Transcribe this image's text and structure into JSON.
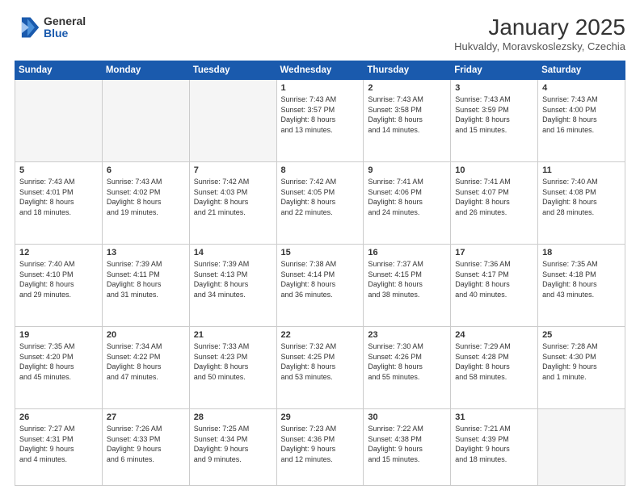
{
  "logo": {
    "general": "General",
    "blue": "Blue"
  },
  "header": {
    "title": "January 2025",
    "location": "Hukvaldy, Moravskoslezsky, Czechia"
  },
  "weekdays": [
    "Sunday",
    "Monday",
    "Tuesday",
    "Wednesday",
    "Thursday",
    "Friday",
    "Saturday"
  ],
  "weeks": [
    [
      {
        "day": "",
        "info": ""
      },
      {
        "day": "",
        "info": ""
      },
      {
        "day": "",
        "info": ""
      },
      {
        "day": "1",
        "info": "Sunrise: 7:43 AM\nSunset: 3:57 PM\nDaylight: 8 hours\nand 13 minutes."
      },
      {
        "day": "2",
        "info": "Sunrise: 7:43 AM\nSunset: 3:58 PM\nDaylight: 8 hours\nand 14 minutes."
      },
      {
        "day": "3",
        "info": "Sunrise: 7:43 AM\nSunset: 3:59 PM\nDaylight: 8 hours\nand 15 minutes."
      },
      {
        "day": "4",
        "info": "Sunrise: 7:43 AM\nSunset: 4:00 PM\nDaylight: 8 hours\nand 16 minutes."
      }
    ],
    [
      {
        "day": "5",
        "info": "Sunrise: 7:43 AM\nSunset: 4:01 PM\nDaylight: 8 hours\nand 18 minutes."
      },
      {
        "day": "6",
        "info": "Sunrise: 7:43 AM\nSunset: 4:02 PM\nDaylight: 8 hours\nand 19 minutes."
      },
      {
        "day": "7",
        "info": "Sunrise: 7:42 AM\nSunset: 4:03 PM\nDaylight: 8 hours\nand 21 minutes."
      },
      {
        "day": "8",
        "info": "Sunrise: 7:42 AM\nSunset: 4:05 PM\nDaylight: 8 hours\nand 22 minutes."
      },
      {
        "day": "9",
        "info": "Sunrise: 7:41 AM\nSunset: 4:06 PM\nDaylight: 8 hours\nand 24 minutes."
      },
      {
        "day": "10",
        "info": "Sunrise: 7:41 AM\nSunset: 4:07 PM\nDaylight: 8 hours\nand 26 minutes."
      },
      {
        "day": "11",
        "info": "Sunrise: 7:40 AM\nSunset: 4:08 PM\nDaylight: 8 hours\nand 28 minutes."
      }
    ],
    [
      {
        "day": "12",
        "info": "Sunrise: 7:40 AM\nSunset: 4:10 PM\nDaylight: 8 hours\nand 29 minutes."
      },
      {
        "day": "13",
        "info": "Sunrise: 7:39 AM\nSunset: 4:11 PM\nDaylight: 8 hours\nand 31 minutes."
      },
      {
        "day": "14",
        "info": "Sunrise: 7:39 AM\nSunset: 4:13 PM\nDaylight: 8 hours\nand 34 minutes."
      },
      {
        "day": "15",
        "info": "Sunrise: 7:38 AM\nSunset: 4:14 PM\nDaylight: 8 hours\nand 36 minutes."
      },
      {
        "day": "16",
        "info": "Sunrise: 7:37 AM\nSunset: 4:15 PM\nDaylight: 8 hours\nand 38 minutes."
      },
      {
        "day": "17",
        "info": "Sunrise: 7:36 AM\nSunset: 4:17 PM\nDaylight: 8 hours\nand 40 minutes."
      },
      {
        "day": "18",
        "info": "Sunrise: 7:35 AM\nSunset: 4:18 PM\nDaylight: 8 hours\nand 43 minutes."
      }
    ],
    [
      {
        "day": "19",
        "info": "Sunrise: 7:35 AM\nSunset: 4:20 PM\nDaylight: 8 hours\nand 45 minutes."
      },
      {
        "day": "20",
        "info": "Sunrise: 7:34 AM\nSunset: 4:22 PM\nDaylight: 8 hours\nand 47 minutes."
      },
      {
        "day": "21",
        "info": "Sunrise: 7:33 AM\nSunset: 4:23 PM\nDaylight: 8 hours\nand 50 minutes."
      },
      {
        "day": "22",
        "info": "Sunrise: 7:32 AM\nSunset: 4:25 PM\nDaylight: 8 hours\nand 53 minutes."
      },
      {
        "day": "23",
        "info": "Sunrise: 7:30 AM\nSunset: 4:26 PM\nDaylight: 8 hours\nand 55 minutes."
      },
      {
        "day": "24",
        "info": "Sunrise: 7:29 AM\nSunset: 4:28 PM\nDaylight: 8 hours\nand 58 minutes."
      },
      {
        "day": "25",
        "info": "Sunrise: 7:28 AM\nSunset: 4:30 PM\nDaylight: 9 hours\nand 1 minute."
      }
    ],
    [
      {
        "day": "26",
        "info": "Sunrise: 7:27 AM\nSunset: 4:31 PM\nDaylight: 9 hours\nand 4 minutes."
      },
      {
        "day": "27",
        "info": "Sunrise: 7:26 AM\nSunset: 4:33 PM\nDaylight: 9 hours\nand 6 minutes."
      },
      {
        "day": "28",
        "info": "Sunrise: 7:25 AM\nSunset: 4:34 PM\nDaylight: 9 hours\nand 9 minutes."
      },
      {
        "day": "29",
        "info": "Sunrise: 7:23 AM\nSunset: 4:36 PM\nDaylight: 9 hours\nand 12 minutes."
      },
      {
        "day": "30",
        "info": "Sunrise: 7:22 AM\nSunset: 4:38 PM\nDaylight: 9 hours\nand 15 minutes."
      },
      {
        "day": "31",
        "info": "Sunrise: 7:21 AM\nSunset: 4:39 PM\nDaylight: 9 hours\nand 18 minutes."
      },
      {
        "day": "",
        "info": ""
      }
    ]
  ]
}
